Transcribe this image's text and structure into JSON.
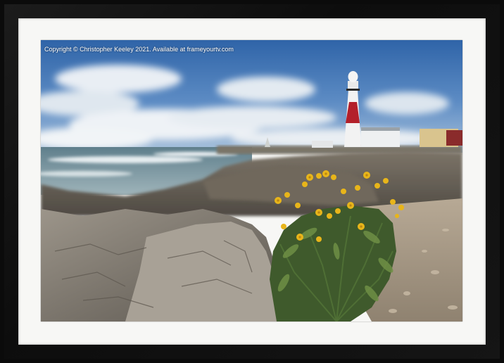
{
  "photo": {
    "copyright_text": "Copyright © Christopher Keeley 2021. Available at frameyourtv.com"
  },
  "colors": {
    "frame": "#0b0b0b",
    "mount": "#f7f7f5",
    "sky": "#3d6fb0",
    "sea": "#6f8e9a",
    "rock": "#8a8478",
    "lighthouse_red": "#b3202a",
    "flowers": "#e8b51a"
  }
}
